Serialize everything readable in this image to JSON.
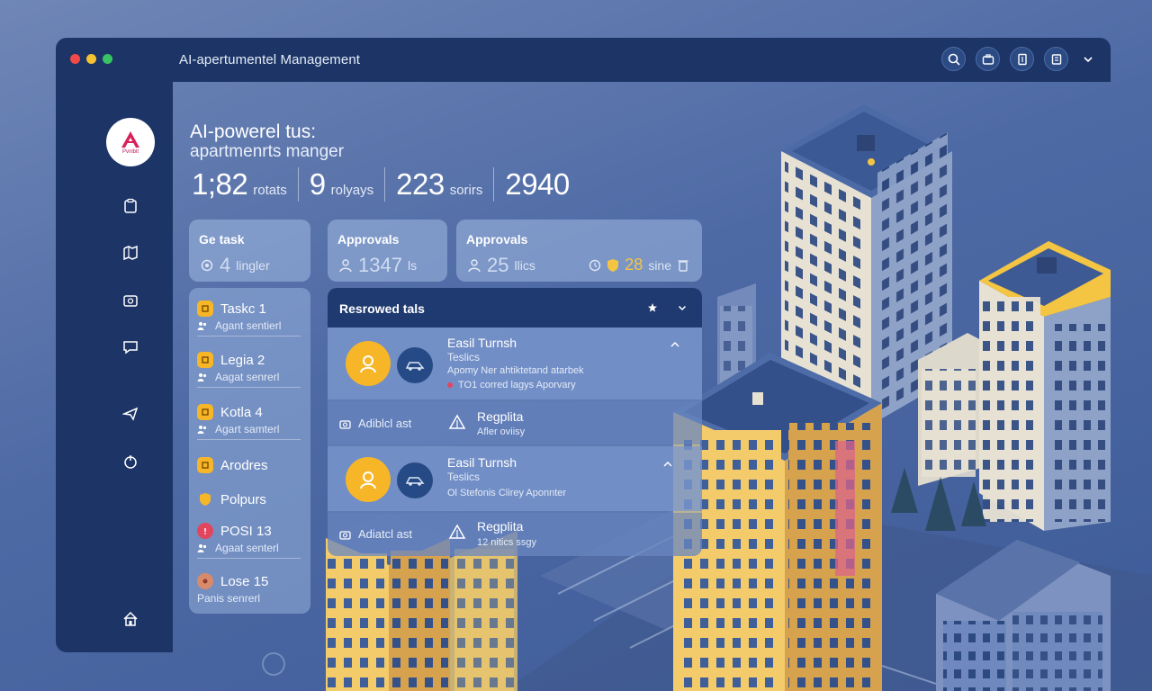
{
  "window": {
    "title": "AI-apertumentel Management",
    "dot_colors": [
      "#f04a4a",
      "#f5c331",
      "#38c464"
    ]
  },
  "topbar": {
    "actions": [
      "search-icon",
      "briefcase-icon",
      "document-icon",
      "list-icon",
      "chevron-down-icon"
    ]
  },
  "sidebar": {
    "logo_text": "Pvnlblt",
    "items": [
      "clipboard-icon",
      "map-icon",
      "camera-icon",
      "chat-icon",
      "send-icon",
      "power-icon"
    ],
    "bottom_item": "home-icon"
  },
  "header": {
    "title_line1": "AI-powerel tus:",
    "title_line2": "apartmenrts manger"
  },
  "stats": [
    {
      "value": "1;82",
      "label": "rotats"
    },
    {
      "value": "9",
      "label": "rolyays"
    },
    {
      "value": "223",
      "label": "sorirs"
    },
    {
      "value": "2940",
      "label": ""
    }
  ],
  "cards": [
    {
      "title": "Ge task",
      "value": "4",
      "unit": "lingler",
      "icon": "gear-icon"
    },
    {
      "title": "Approvals",
      "value": "1347",
      "unit": "ls",
      "icon": "user-icon"
    },
    {
      "title": "Approvals",
      "value": "25",
      "unit": "llics",
      "icon": "user-icon",
      "extra_value": "28",
      "extra_unit": "sine",
      "extra_icons": [
        "clock-icon",
        "shield-icon",
        "trash-icon"
      ]
    }
  ],
  "tasks": [
    {
      "name": "Taskc 1",
      "sub": "Agant sentierl",
      "badge_color": "#f6b628"
    },
    {
      "name": "Legia 2",
      "sub": "Aagat senrerl",
      "badge_color": "#f6b628"
    },
    {
      "name": "Kotla 4",
      "sub": "Agart samterl",
      "badge_color": "#f6b628"
    },
    {
      "name": "Arodres",
      "sub": "",
      "badge_color": "#f6b628"
    },
    {
      "name": "Polpurs",
      "sub": "",
      "badge_color": "#f6b628"
    },
    {
      "name": "POSI 13",
      "sub": "Agaat senterl",
      "badge_color": "#e2465e"
    },
    {
      "name": "Lose 15",
      "sub": "Panis senrerl",
      "badge_color": "#d98a6a"
    }
  ],
  "reviewed": {
    "title": "Resrowed tals",
    "entries": [
      {
        "title": "Easil Turnsh",
        "subtitle": "Teslics",
        "desc": "Apomy Ner ahtiktetand atarbek",
        "note": "TO1 corred lagys Aporvary"
      },
      {
        "label": "Adiblcl ast",
        "title": "Regplita",
        "subtitle": "Afler oviisy"
      },
      {
        "title": "Easil Turnsh",
        "subtitle": "Teslics",
        "desc": "Ol Stefonis Clirey Aponnter",
        "note": ""
      },
      {
        "label": "Adiatcl ast",
        "title": "Regplita",
        "subtitle": "12 nitics ssgy"
      }
    ]
  },
  "accent_colors": {
    "chrome": "#1c3566",
    "badge_yellow": "#f6b628",
    "badge_red": "#e2465e"
  }
}
